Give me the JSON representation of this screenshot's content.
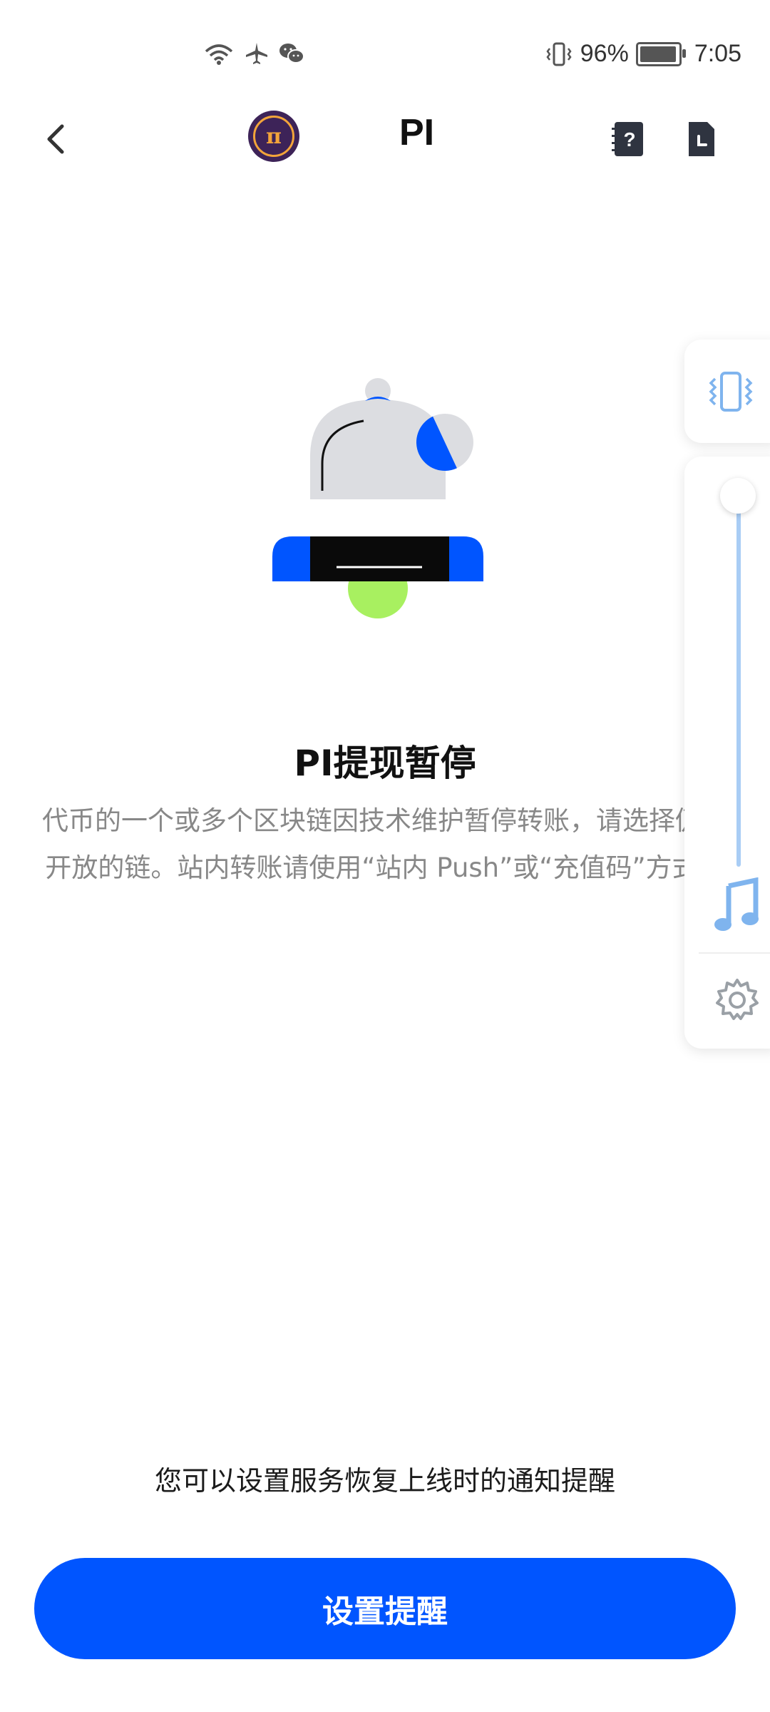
{
  "status_bar": {
    "battery_percent": "96%",
    "battery_level": 0.96,
    "time": "7:05",
    "icons": [
      "wifi-icon",
      "airplane-icon",
      "wechat-icon",
      "vibrate-icon",
      "battery-icon"
    ]
  },
  "header": {
    "title": "PI",
    "icons": [
      "back-icon",
      "pi-logo-icon",
      "help-document-icon",
      "history-document-icon"
    ]
  },
  "main": {
    "heading": "PI提现暂停",
    "description": "代币的一个或多个区块链因技术维护暂停转账，请选择仍然开放的链。站内转账请使用“站内 Push”或“充值码”方式。",
    "hint": "您可以设置服务恢复上线时的通知提醒",
    "button_label": "设置提醒"
  },
  "volume_overlay": {
    "level": 1.0,
    "icons": [
      "vibrate-mode-icon",
      "music-icon",
      "settings-gear-icon"
    ]
  },
  "colors": {
    "accent": "#0055ff",
    "bell_body": "#dcdde1",
    "bell_accent": "#0055ff",
    "bell_green": "#a8f060",
    "volume_blue": "#a9cdf5"
  }
}
